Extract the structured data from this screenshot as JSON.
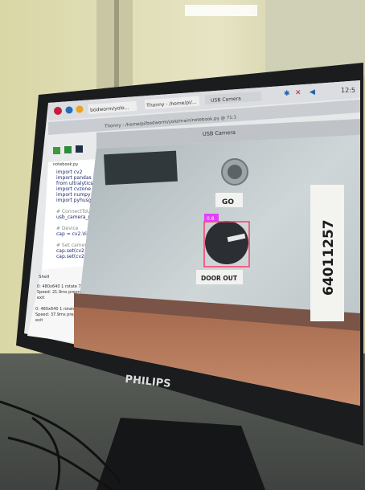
{
  "taskbar": {
    "menu_label": "Menu",
    "tasks": [
      "bodworm/yolo...",
      "Thonny - /home/pi/...",
      "USB Camera"
    ],
    "clock": "12:5"
  },
  "thonny": {
    "title": "Thonny - /home/pi/bodworm/yolo/main/notebook.py @ 71:1",
    "tab": "notebook.py",
    "code_lines": [
      "import cv2",
      "import pandas as",
      "from ultralytics",
      "import cvzone",
      "import numpy as",
      "import pyhusgl",
      "",
      "# ConnectToUsbCa",
      "usb_camera_port",
      "",
      "# Device",
      "cap = cv2.VideoC",
      "",
      "# Set camera sett",
      "cap.set(cv2.CAP",
      "cap.set(cv2.CAP"
    ],
    "shell_label": "Shell",
    "shell_lines": [
      "0: 480x640 1 rotate 75.",
      "Speed: 21.9ms preprocess",
      "  exit",
      "",
      "0: 480x640 1 rotate 75.",
      "Speed: 37.9ms preprocess",
      "  exit"
    ]
  },
  "camera_window": {
    "title": "USB Camera",
    "sign_go": "GO",
    "sign_door_out": "DOOR OUT",
    "side_number": "64011257",
    "detection_label": "0.8"
  },
  "monitor": {
    "brand": "PHILIPS"
  },
  "colors": {
    "detection_box": "#ff3b6b",
    "detection_tag": "#e040fb"
  }
}
